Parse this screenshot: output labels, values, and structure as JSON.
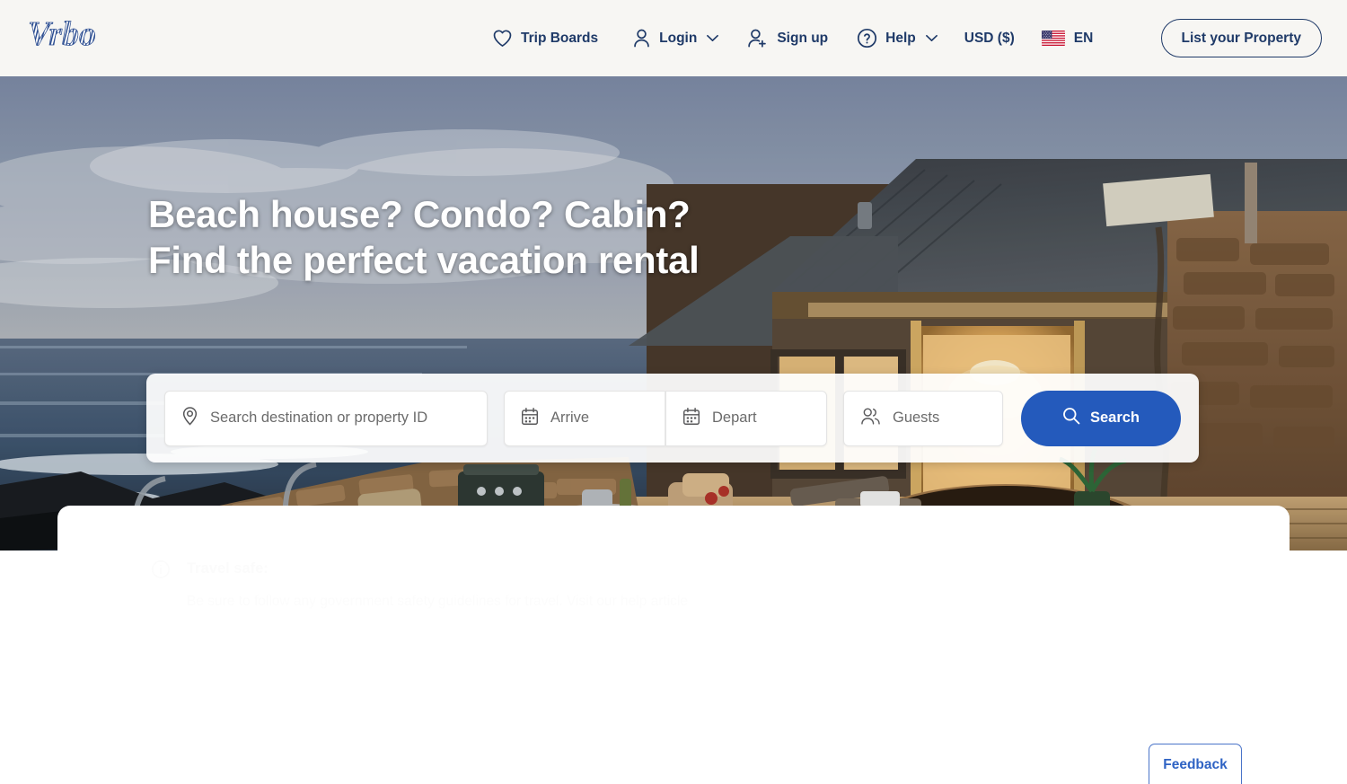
{
  "brand": {
    "name": "Vrbo",
    "logo_icon": "vrbo-wordmark-logo",
    "navy": "#1f3a68",
    "accent_blue": "#245abc"
  },
  "header": {
    "nav": [
      {
        "label": "Trip Boards",
        "icon": "heart-icon",
        "has_chevron": false
      },
      {
        "label": "Login",
        "icon": "user-icon",
        "has_chevron": true
      },
      {
        "label": "Sign up",
        "icon": "user-plus-icon",
        "has_chevron": false
      },
      {
        "label": "Help",
        "icon": "question-circle-icon",
        "has_chevron": true
      }
    ],
    "currency": "USD ($)",
    "language": {
      "label": "EN",
      "icon": "us-flag-icon"
    },
    "list_property": "List your Property"
  },
  "hero": {
    "title_line1": "Beach house? Condo? Cabin?",
    "title_line2": "Find the perfect vacation rental",
    "image_alt": "clifftop-vacation-rental-at-dusk-with-hot-tub-and-ocean-view"
  },
  "search": {
    "destination_placeholder": "Search destination or property ID",
    "destination_value": "",
    "destination_icon": "map-pin-icon",
    "arrive_placeholder": "Arrive",
    "arrive_value": "",
    "arrive_icon": "calendar-icon",
    "depart_placeholder": "Depart",
    "depart_value": "",
    "depart_icon": "calendar-icon",
    "guests_placeholder": "Guests",
    "guests_value": "",
    "guests_icon": "people-icon",
    "search_button": "Search",
    "search_button_icon": "magnifier-icon"
  },
  "travel_safe": {
    "icon": "info-circle-icon",
    "title": "Travel safe:",
    "body": "Be sure to follow any government safety guidelines for travel. Visit our help article"
  },
  "feedback": {
    "label": "Feedback"
  }
}
